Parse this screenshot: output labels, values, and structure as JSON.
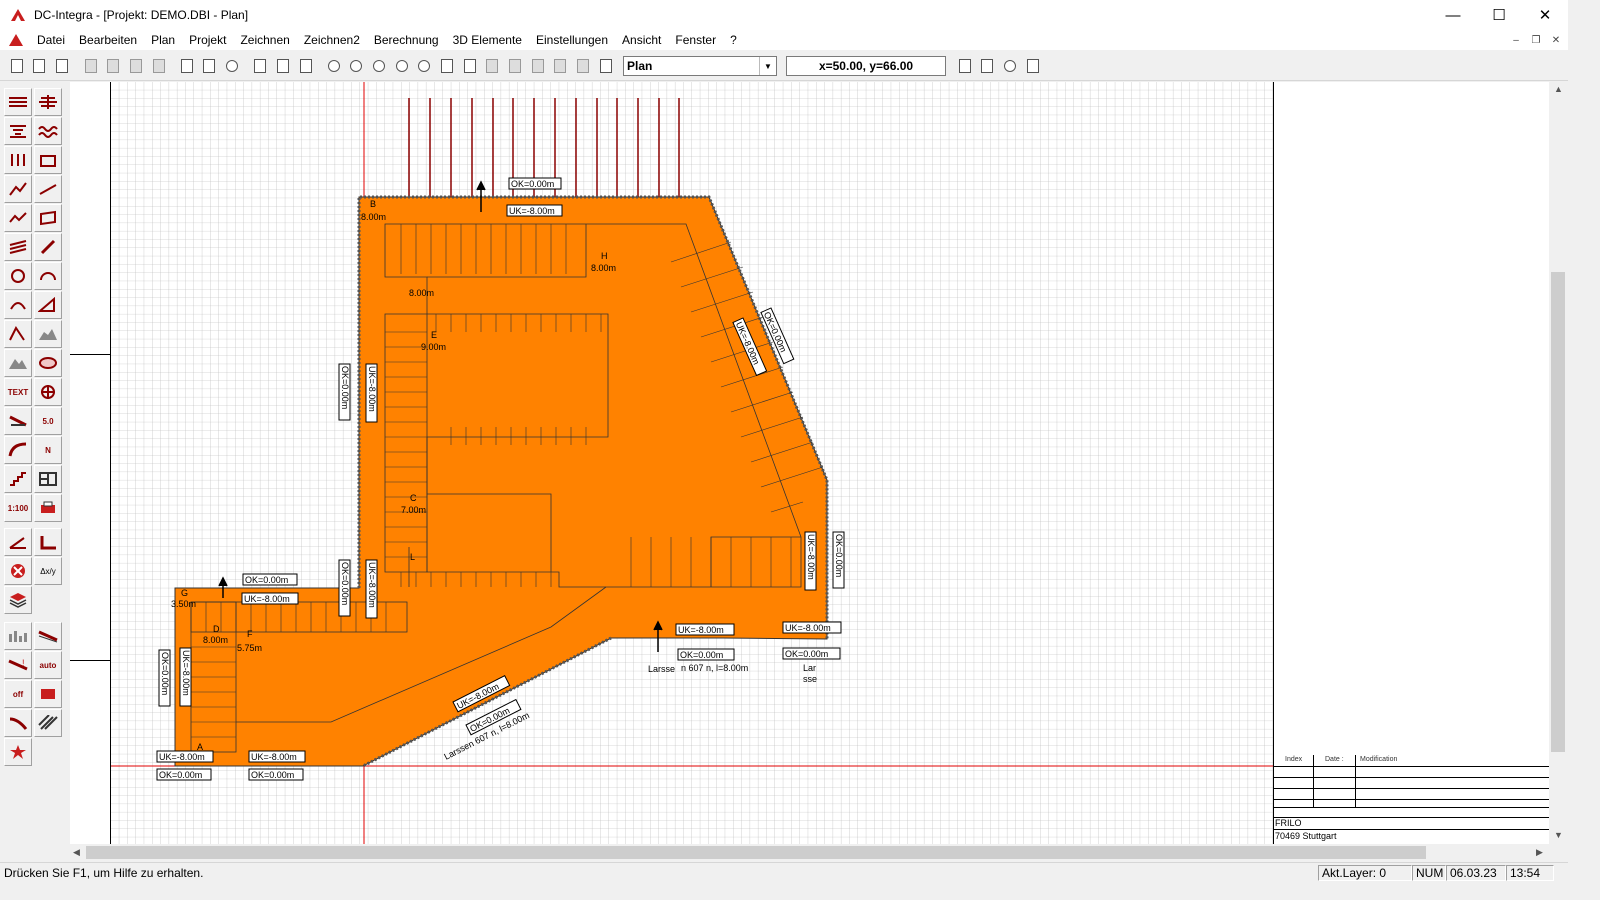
{
  "window": {
    "title": "DC-Integra - [Projekt: DEMO.DBI - Plan]",
    "controls": [
      "minimize-icon",
      "maximize-icon",
      "close-icon"
    ]
  },
  "menu": {
    "items": [
      "Datei",
      "Bearbeiten",
      "Plan",
      "Projekt",
      "Zeichnen",
      "Zeichnen2",
      "Berechnung",
      "3D Elemente",
      "Einstellungen",
      "Ansicht",
      "Fenster",
      "?"
    ]
  },
  "toolbar": {
    "view_select": "Plan",
    "coordinates": "x=50.00, y=66.00"
  },
  "palette": {
    "text_tool": "TEXT",
    "dim_tool": "5.0",
    "north_tool": "N",
    "scale_tool": "1:100",
    "delta_tool": "Δx/y",
    "off_tool": "off",
    "auto_tool": "auto"
  },
  "drawing": {
    "fill_color": "#ff8200",
    "grid_color": "#b4b4b4",
    "axis_color": "#e00000",
    "points": [
      "B",
      "H",
      "E",
      "C",
      "L",
      "G",
      "D",
      "F",
      "A"
    ],
    "levels": [
      "8.00m",
      "8.00m",
      "8.00m",
      "9.00m",
      "7.00m",
      "3.50m",
      "8.00m",
      "5.75m"
    ],
    "labels": {
      "ok_top": "OK=0.00m",
      "uk_top": "UK=-8.00m",
      "ok_left": "OK=0.00m",
      "uk_left": "UK=-8.00m",
      "ok_mid": "OK=0.00m",
      "uk_mid": "UK=-8.00m",
      "ok_lower": "OK=0.00m",
      "uk_lower": "UK=-8.00m",
      "ok_right_diag": "OK=0.00m",
      "uk_right_diag": "UK=-8.00m",
      "ok_right": "OK=0.00m",
      "uk_right": "UK=-8.00m",
      "uk_br1": "UK=-8.00m",
      "uk_br2": "UK=-8.00m",
      "ok_br1": "OK=0.00m",
      "ok_br2": "OK=0.00m",
      "larssen_short": "Larsse",
      "larssen_spec": "n 607 n, l=8.00m",
      "lar": "Lar",
      "sse": "sse",
      "uk_diag": "UK=-8.00m",
      "ok_diag": "OK=0.00m",
      "larssen_diag": "Larssen 607 n, l=8.00m",
      "uk_far_left": "UK=-8.00m",
      "ok_far_left": "OK=0.00m",
      "uk_bl1": "UK=-8.00m",
      "uk_bl2": "UK=-8.00m",
      "ok_bl1": "OK=0.00m",
      "ok_bl2": "OK=0.00m",
      "ok_low_strip": "OK=0.00m",
      "uk_low_strip": "UK=-8.00m"
    }
  },
  "title_block": {
    "headers": [
      "Index",
      "Date :",
      "Modification"
    ],
    "company": "FRILO",
    "address": "70469 Stuttgart"
  },
  "status": {
    "help": "Drücken Sie F1, um Hilfe zu erhalten.",
    "layer": "Akt.Layer: 0",
    "num": "NUM",
    "date": "06.03.23",
    "time": "13:54"
  }
}
